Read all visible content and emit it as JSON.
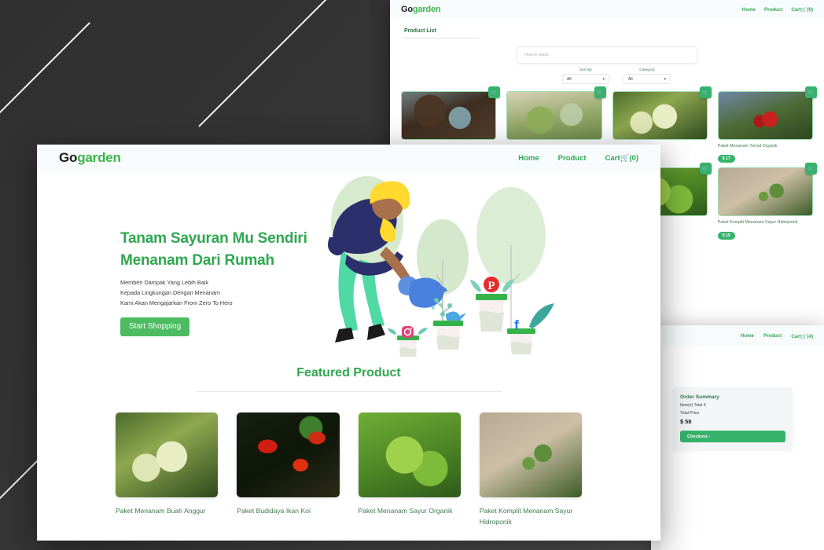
{
  "backdrop": {
    "color": "#333333",
    "line_color": "#f2f2f2"
  },
  "brand": {
    "first": "Go",
    "second": "garden"
  },
  "colors": {
    "green_primary": "#35b36a",
    "green_heading": "#2ea84f",
    "green_link": "#34a853",
    "nav_bg": "#f7fbfb",
    "price_badge": "#35b36a"
  },
  "home_window": {
    "nav": {
      "home": "Home",
      "product": "Product",
      "cart_label": "Cart",
      "cart_icon": "shopping-cart-icon",
      "cart_count": "(0)"
    },
    "hero": {
      "heading_line1": "Tanam Sayuran Mu Sendiri",
      "heading_line2": "Menanam Dari Rumah",
      "sub_line1": "Memberi Dampak Yang Lebih Baik",
      "sub_line2": "Kepada Lingkungan Dengan Menanam",
      "sub_line3": "Kami Akan Mengajarkan From Zero To Hero",
      "cta": "Start Shopping"
    },
    "featured": {
      "title": "Featured Product",
      "products": [
        {
          "name": "Paket Menanam Buah Anggur",
          "art": "ph-grape"
        },
        {
          "name": "Paket Budidaya Ikan Koi",
          "art": "ph-koi"
        },
        {
          "name": "Paket Menanam Sayur Organik",
          "art": "ph-kale"
        },
        {
          "name": "Paket Komplit Menanam Sayur Hidroponik",
          "art": "ph-tomato-green"
        }
      ]
    }
  },
  "product_window": {
    "nav": {
      "home": "Home",
      "product": "Product",
      "cart_label": "Cart",
      "cart_icon": "shopping-cart-icon",
      "cart_count": "(0)"
    },
    "page_title": "Product List",
    "search": {
      "placeholder": "How to plant...",
      "value": ""
    },
    "filters": [
      {
        "label": "Sort By",
        "value": "All"
      },
      {
        "label": "Category",
        "value": "All"
      }
    ],
    "products": [
      {
        "name": "",
        "price": "",
        "art": "ph-soil"
      },
      {
        "name": "",
        "price": "",
        "art": "ph-bed"
      },
      {
        "name": "",
        "price": "",
        "art": "ph-grape"
      },
      {
        "name": "Paket Menanam Tomat Organik",
        "price": "$ 17",
        "art": "ph-tomato-red"
      },
      {
        "name": "",
        "price": "",
        "art": "ph-kale"
      },
      {
        "name": "Paket Komplit Menanam Sayur Hidroponik",
        "price": "$ 15",
        "art": "ph-tomato-green"
      }
    ]
  },
  "cart_window": {
    "nav": {
      "home": "Home",
      "product": "Product",
      "cart_label": "Cart",
      "cart_icon": "shopping-cart-icon",
      "cart_count": "(4)"
    },
    "order_summary": {
      "title": "Order Summary",
      "items_total": "Item(s) Total 4",
      "total_price_label": "Total Price",
      "total_price": "$ 58",
      "checkout": "Checkout ›"
    }
  }
}
